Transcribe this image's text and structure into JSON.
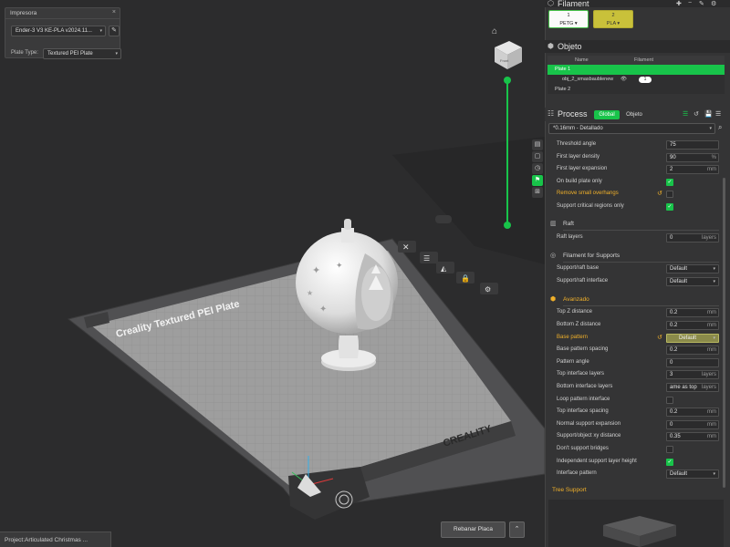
{
  "printer_panel": {
    "title": "Impresora",
    "close": "×",
    "printer": "Ender-3 V3 KE-PLA v2024.11...",
    "plate_type_label": "Plate Type:",
    "plate_type": "Textured PEI Plate"
  },
  "viewport": {
    "bed_label": "Creality Textured PEI Plate",
    "bed_brand": "CREALITY",
    "cube_label": "Front",
    "project": "Project:Articulated Christmas ...",
    "slice_button": "Rebanar Placa",
    "slice_up": "⌃"
  },
  "filament": {
    "title": "Filament",
    "items": [
      {
        "index": "1",
        "name": "PETG",
        "color": "#fafafa"
      },
      {
        "index": "2",
        "name": "PLA",
        "color": "#c9c13a"
      }
    ]
  },
  "objects": {
    "title": "Objeto",
    "col_name": "Name",
    "col_filament": "Filament",
    "rows": [
      {
        "name": "Plate 1",
        "selected": true
      },
      {
        "name": "obj_2_xmasbaublenew",
        "filament": "1"
      },
      {
        "name": "Plate 2"
      }
    ]
  },
  "process": {
    "title": "Process",
    "tab_global": "Global",
    "tab_object": "Objeto",
    "preset": "*0.16mm - Detallado"
  },
  "params": {
    "threshold_angle": {
      "label": "Threshold angle",
      "value": "75"
    },
    "first_layer_density": {
      "label": "First layer density",
      "value": "90",
      "unit": "%"
    },
    "first_layer_expansion": {
      "label": "First layer expansion",
      "value": "2",
      "unit": "mm"
    },
    "on_build_plate": {
      "label": "On build plate only"
    },
    "remove_small_overhangs": {
      "label": "Remove small overhangs"
    },
    "support_critical": {
      "label": "Support critical regions only"
    },
    "raft_group": "Raft",
    "raft_layers": {
      "label": "Raft layers",
      "value": "0",
      "unit": "layers"
    },
    "filament_support_group": "Filament for Supports",
    "support_raft_base": {
      "label": "Support/raft base",
      "value": "Default"
    },
    "support_raft_interface": {
      "label": "Support/raft interface",
      "value": "Default"
    },
    "advanced_group": "Avanzado",
    "top_z_distance": {
      "label": "Top Z distance",
      "value": "0.2",
      "unit": "mm"
    },
    "bottom_z_distance": {
      "label": "Bottom Z distance",
      "value": "0.2",
      "unit": "mm"
    },
    "base_pattern": {
      "label": "Base pattern",
      "value": "Default"
    },
    "base_pattern_spacing": {
      "label": "Base pattern spacing",
      "value": "0.2",
      "unit": "mm"
    },
    "pattern_angle": {
      "label": "Pattern angle",
      "value": "0"
    },
    "top_interface_layers": {
      "label": "Top interface layers",
      "value": "3",
      "unit": "layers"
    },
    "bottom_interface_layers": {
      "label": "Bottom interface layers",
      "value": "ame as top",
      "unit": "layers"
    },
    "loop_pattern_interface": {
      "label": "Loop pattern interface"
    },
    "top_interface_spacing": {
      "label": "Top interface spacing",
      "value": "0.2",
      "unit": "mm"
    },
    "normal_support_expansion": {
      "label": "Normal support expansion",
      "value": "0",
      "unit": "mm"
    },
    "support_object_xy": {
      "label": "Support/object xy distance",
      "value": "0.35",
      "unit": "mm"
    },
    "dont_support_bridges": {
      "label": "Don't support bridges"
    },
    "independent_support_height": {
      "label": "Independent support layer height"
    },
    "interface_pattern": {
      "label": "Interface pattern",
      "value": "Default"
    },
    "tree_support_group": "Tree Support"
  }
}
